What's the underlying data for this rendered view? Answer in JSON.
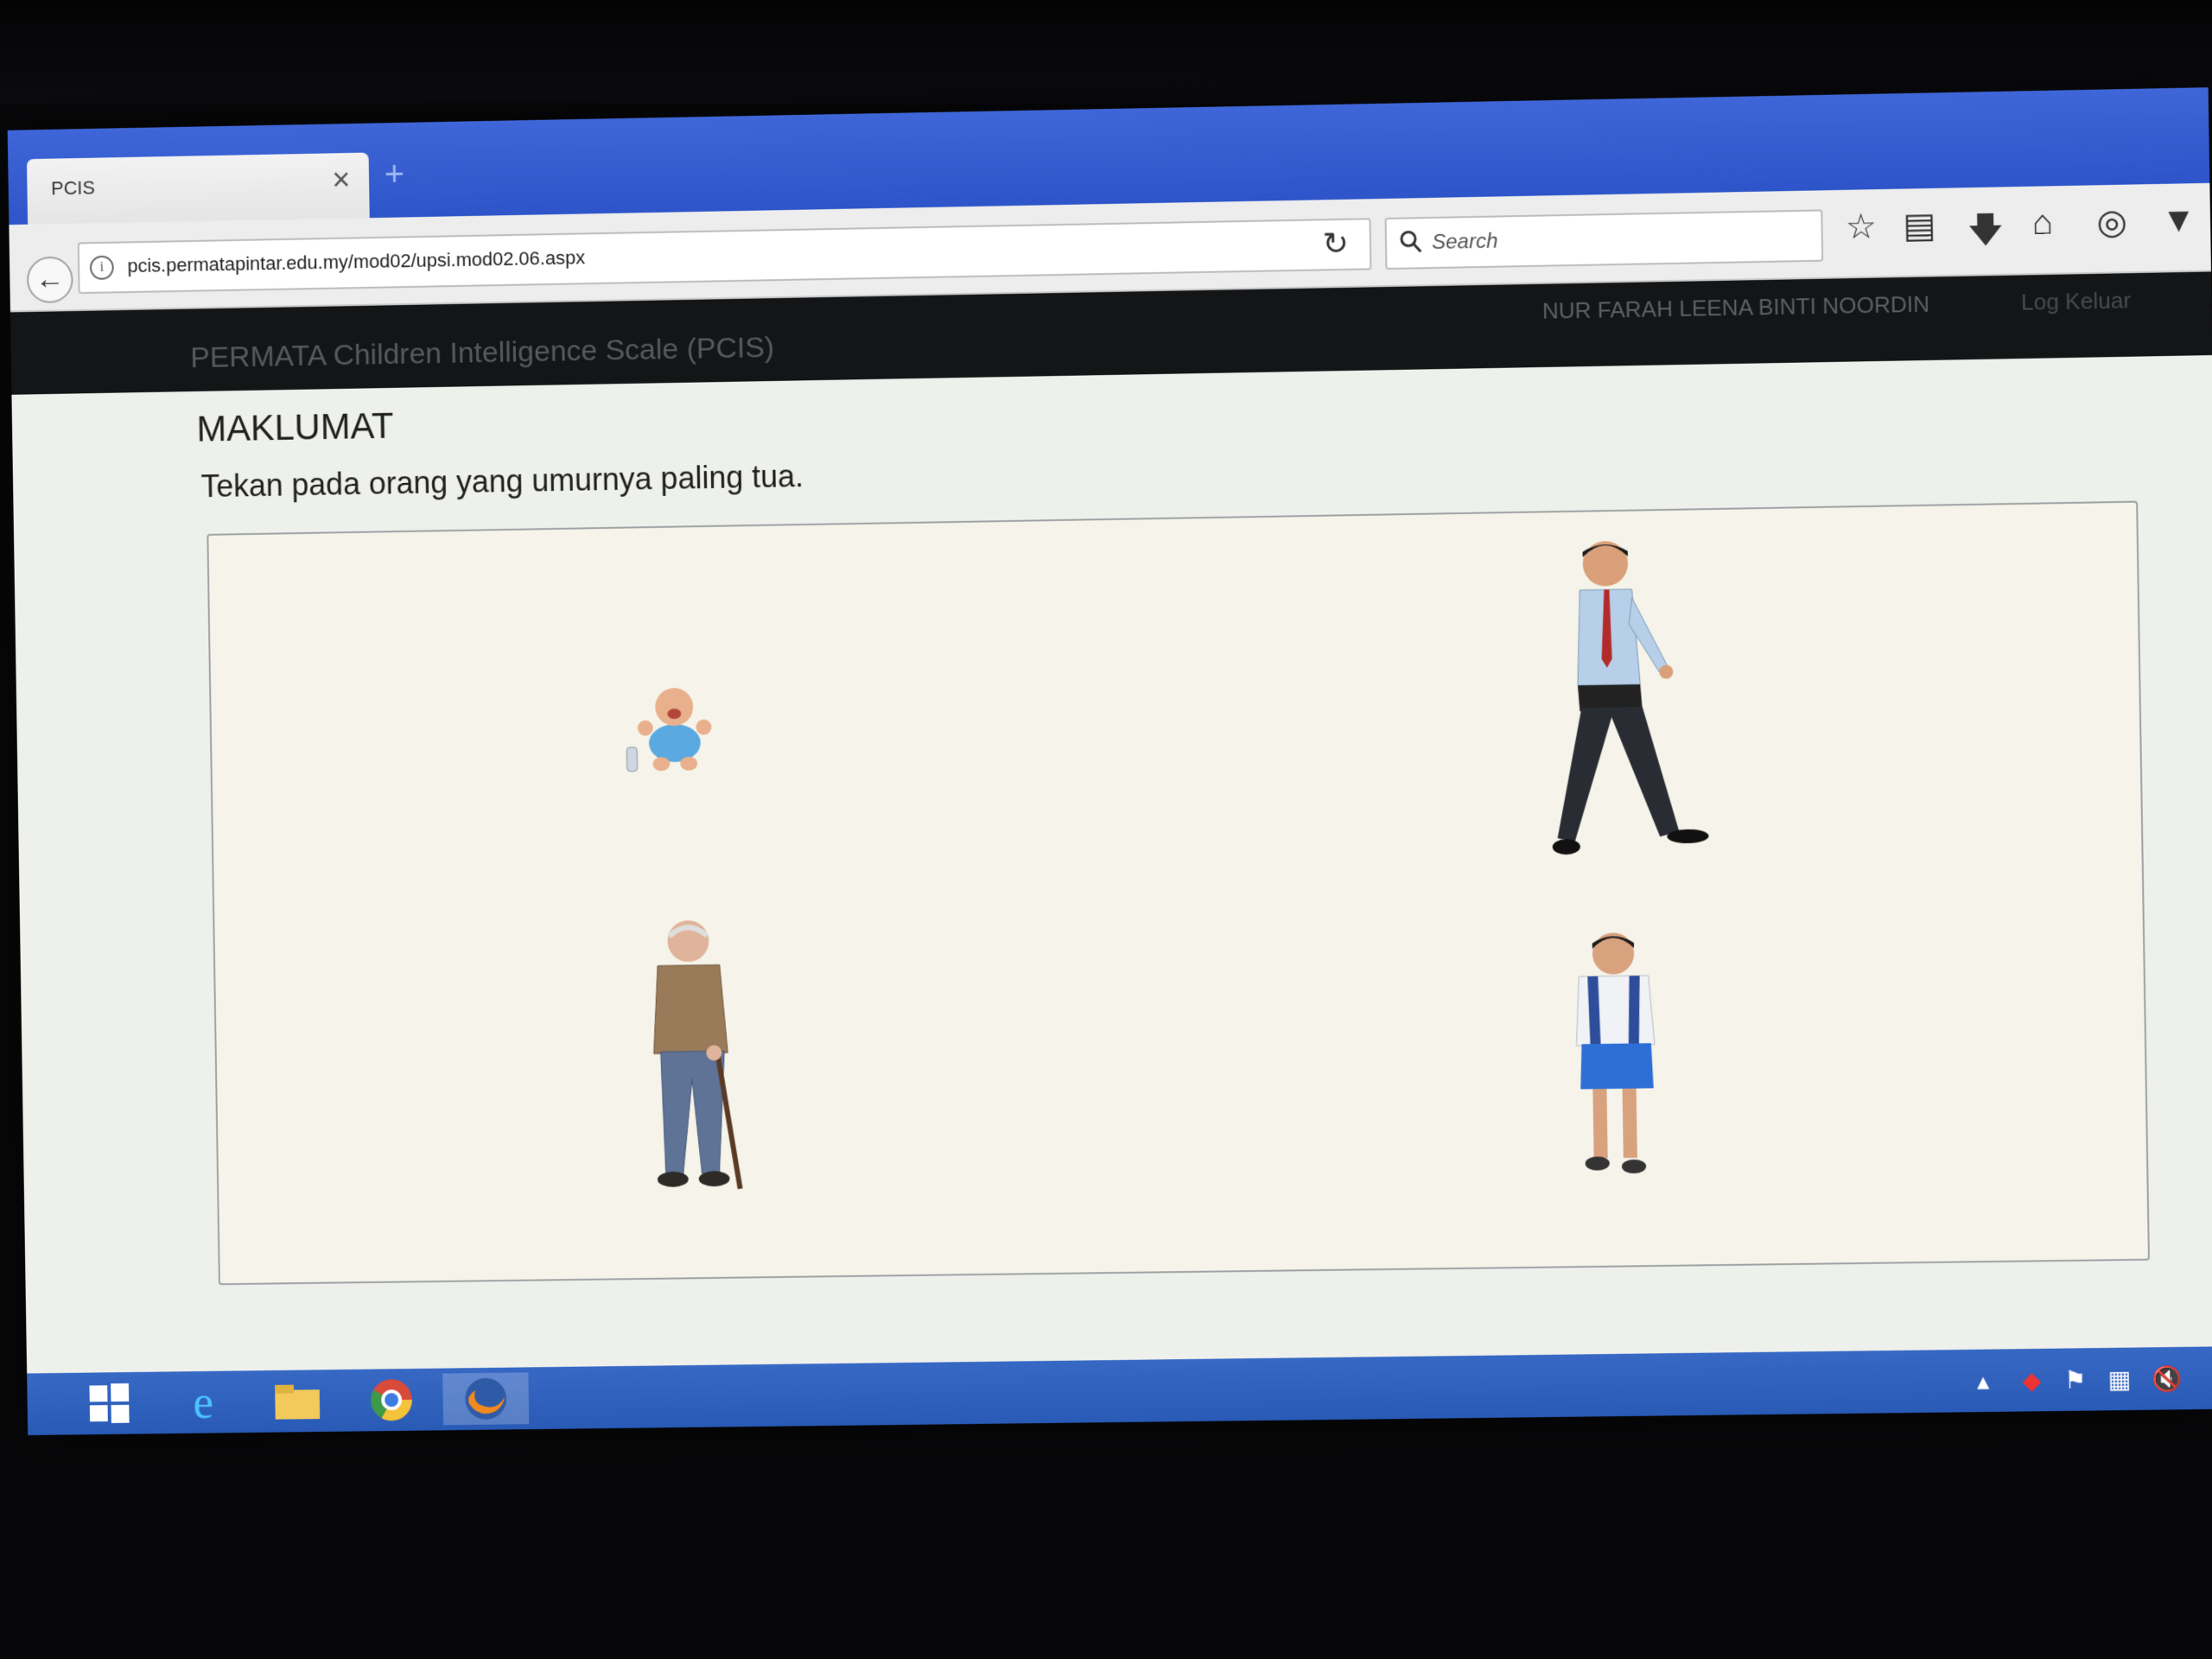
{
  "browser": {
    "tab_title": "PCIS",
    "tab_close": "×",
    "new_tab": "+",
    "url": "pcis.permatapintar.edu.my/mod02/upsi.mod02.06.aspx",
    "search_placeholder": "Search",
    "icons": [
      "back-icon",
      "info-icon",
      "reload-icon",
      "search-icon",
      "bookmark-star-icon",
      "reading-list-icon",
      "download-icon",
      "home-icon",
      "sync-icon",
      "pocket-icon"
    ]
  },
  "header": {
    "app_title": "PERMATA Children Intelligence Scale (PCIS)",
    "user_name": "NUR FARAH LEENA BINTI NOORDIN",
    "logout": "Log Keluar"
  },
  "main": {
    "section_title": "MAKLUMAT",
    "instruction": "Tekan pada orang yang umurnya paling tua.",
    "figures": [
      "baby-figure",
      "man-figure",
      "elderly-man-figure",
      "schoolboy-figure"
    ]
  },
  "taskbar": {
    "apps": [
      "windows-start-icon",
      "internet-explorer-icon",
      "file-explorer-icon",
      "chrome-icon",
      "firefox-icon"
    ],
    "tray": [
      "tray-expand-icon",
      "antivirus-icon",
      "action-center-flag-icon",
      "network-icon",
      "volume-muted-icon"
    ]
  },
  "colors": {
    "tabbar": "#2d55c9",
    "header_bg": "#141517",
    "panel_bg": "#f6f4ea",
    "taskbar": "#2c5cba"
  }
}
